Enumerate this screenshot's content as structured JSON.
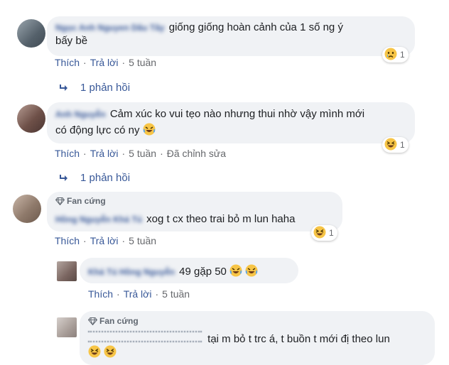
{
  "comments": [
    {
      "author": "Ngọc Anh Nguyen Dâu Tây",
      "text_line1": "giống giống hoàn cảnh của 1 số ng ý",
      "text_line2": "bấy bề",
      "actions": {
        "like": "Thích",
        "reply": "Trả lời",
        "time": "5 tuần"
      },
      "reaction": {
        "icon": "crying-face-icon",
        "count": "1"
      },
      "replies_link": "1 phản hồi"
    },
    {
      "author": "Anh Nguyễn",
      "text_line1": "Cảm xúc ko vui tẹo nào nhưng thui nhờ vậy mình mới",
      "text_line2": "có động lực có ny",
      "actions": {
        "like": "Thích",
        "reply": "Trả lời",
        "time": "5 tuần",
        "edited": "Đã chỉnh sửa"
      },
      "reaction": {
        "icon": "laughing-face-icon",
        "count": "1"
      },
      "replies_link": "1 phản hồi"
    },
    {
      "badge": "Fan cứng",
      "author": "Hồng Nguyễn Khả Tú",
      "text_line1": "xog t cx theo trai bỏ m lun haha",
      "actions": {
        "like": "Thích",
        "reply": "Trả lời",
        "time": "5 tuần"
      },
      "reaction": {
        "icon": "laughing-face-icon",
        "count": "1"
      }
    }
  ],
  "replies": [
    {
      "author": "Khả Tú Hồng Nguyễn",
      "text_line1": "49 gặp 50",
      "actions": {
        "like": "Thích",
        "reply": "Trả lời",
        "time": "5 tuần"
      }
    },
    {
      "badge": "Fan cứng",
      "author": "Hồng Nguyễn",
      "text_line1": "tại m bỏ t trc á, t buồn t mới đị theo lun"
    }
  ],
  "colors": {
    "link": "#385898",
    "muted": "#65676b",
    "bubble": "#f0f2f5",
    "emoji_yellow": "#f7c547"
  }
}
